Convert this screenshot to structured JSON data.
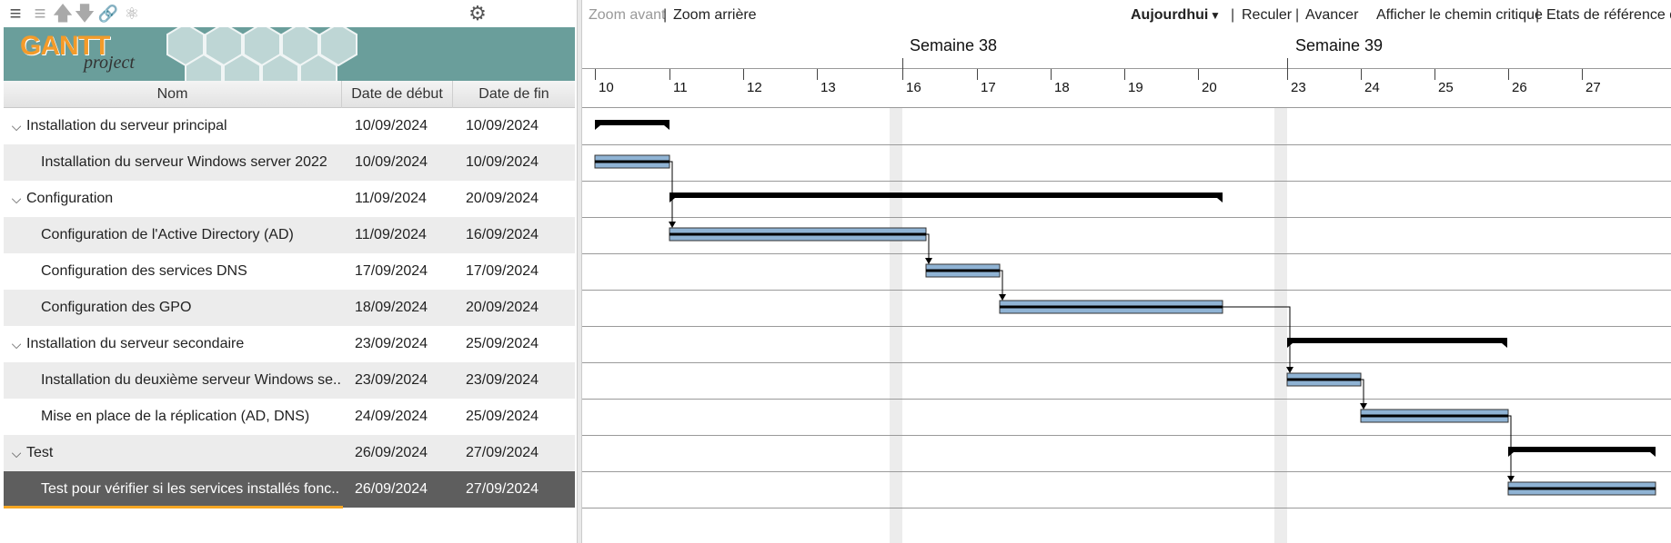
{
  "toolbar": {
    "icons": [
      "indent-icon",
      "outdent-icon",
      "move-up-icon",
      "move-down-icon",
      "link-icon",
      "unlink-icon",
      "gear-icon"
    ]
  },
  "logo": {
    "text": "GANTT",
    "sub": "project"
  },
  "columns": {
    "name": "Nom",
    "start": "Date de début",
    "end": "Date de fin"
  },
  "tasks": [
    {
      "name": "Installation du serveur principal",
      "start": "10/09/2024",
      "end": "10/09/2024",
      "group": true
    },
    {
      "name": "Installation du serveur Windows server 2022",
      "start": "10/09/2024",
      "end": "10/09/2024",
      "group": false
    },
    {
      "name": "Configuration",
      "start": "11/09/2024",
      "end": "20/09/2024",
      "group": true
    },
    {
      "name": "Configuration de l'Active Directory (AD)",
      "start": "11/09/2024",
      "end": "16/09/2024",
      "group": false
    },
    {
      "name": "Configuration des services DNS",
      "start": "17/09/2024",
      "end": "17/09/2024",
      "group": false
    },
    {
      "name": "Configuration des GPO",
      "start": "18/09/2024",
      "end": "20/09/2024",
      "group": false
    },
    {
      "name": "Installation du serveur secondaire",
      "start": "23/09/2024",
      "end": "25/09/2024",
      "group": true
    },
    {
      "name": "Installation du deuxième serveur Windows se...",
      "start": "23/09/2024",
      "end": "23/09/2024",
      "group": false
    },
    {
      "name": "Mise en place de la réplication (AD, DNS)",
      "start": "24/09/2024",
      "end": "25/09/2024",
      "group": false
    },
    {
      "name": "Test",
      "start": "26/09/2024",
      "end": "27/09/2024",
      "group": true
    },
    {
      "name": "Test pour vérifier si les services installés fonc...",
      "start": "26/09/2024",
      "end": "27/09/2024",
      "group": false,
      "selected": true
    }
  ],
  "chart_toolbar": {
    "zoom_in": "Zoom avant",
    "zoom_out": "Zoom arrière",
    "today": "Aujourdhui",
    "back": "Reculer",
    "forward": "Avancer",
    "critical": "Afficher le chemin critique",
    "baseline": "Etats de référence du"
  },
  "timeline": {
    "weeks": [
      "Semaine 38",
      "Semaine 39"
    ],
    "days": [
      "10",
      "11",
      "12",
      "13",
      "16",
      "17",
      "18",
      "19",
      "20",
      "23",
      "24",
      "25",
      "26",
      "27"
    ]
  },
  "colors": {
    "bar_fill": "#8fb3d4",
    "bar_border": "#333333",
    "summary": "#000000",
    "selected_row": "#5e5e5e",
    "accent": "#f5a623"
  }
}
